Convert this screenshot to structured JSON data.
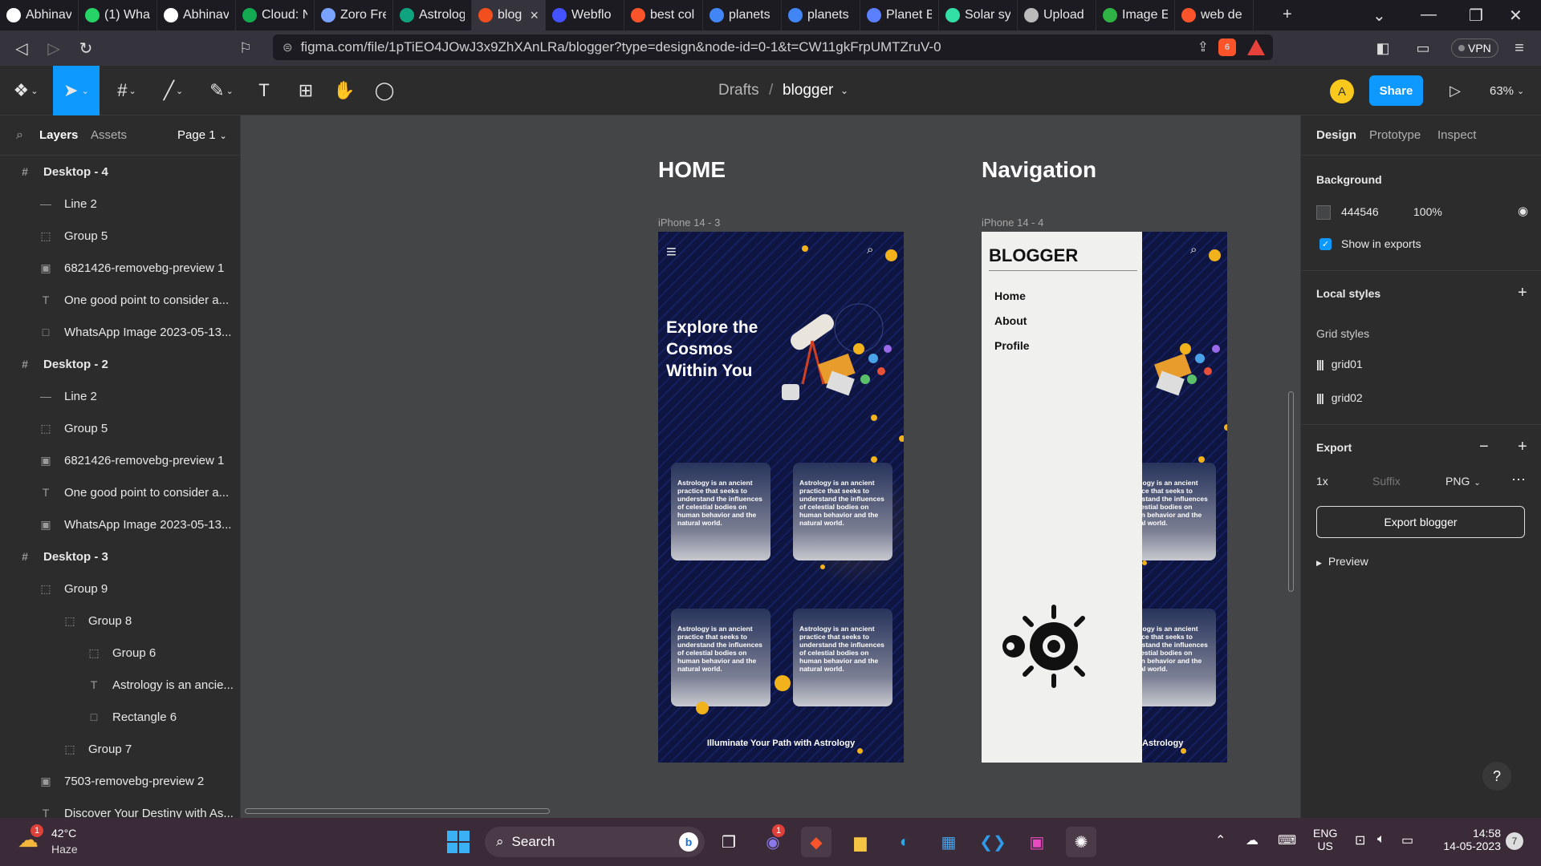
{
  "browser": {
    "tabs": [
      {
        "label": "Abhinav",
        "icon": "github-icon",
        "color": "#ffffff"
      },
      {
        "label": "(1) Wha",
        "icon": "whatsapp-icon",
        "color": "#25d366"
      },
      {
        "label": "Abhinav",
        "icon": "webflow-w-icon",
        "color": "#ffffff"
      },
      {
        "label": "Cloud: N",
        "icon": "mongodb-leaf-icon",
        "color": "#13aa52"
      },
      {
        "label": "Zoro Fre",
        "icon": "zoro-icon",
        "color": "#7aa3ff"
      },
      {
        "label": "Astrolog",
        "icon": "chatgpt-icon",
        "color": "#10a37f"
      },
      {
        "label": "blog",
        "icon": "figma-icon",
        "color": "#f24e1e"
      },
      {
        "label": "Webflo",
        "icon": "webflow-icon",
        "color": "#4353ff"
      },
      {
        "label": "best col",
        "icon": "brave-search-icon",
        "color": "#fb542b"
      },
      {
        "label": "planets",
        "icon": "google-icon",
        "color": "#4285f4"
      },
      {
        "label": "planets",
        "icon": "google-icon",
        "color": "#4285f4"
      },
      {
        "label": "Planet B",
        "icon": "planet-icon",
        "color": "#5b7fff"
      },
      {
        "label": "Solar sy",
        "icon": "vuetify-icon",
        "color": "#32e0a6"
      },
      {
        "label": "Upload",
        "icon": "stack-icon",
        "color": "#bbbbbb"
      },
      {
        "label": "Image E",
        "icon": "image-editor-icon",
        "color": "#2fb344"
      },
      {
        "label": "web de",
        "icon": "brave-search-icon",
        "color": "#fb542b"
      }
    ],
    "url": "figma.com/file/1pTiEO4JOwJ3x9ZhXAnLRa/blogger?type=design&node-id=0-1&t=CW11gkFrpUMTZruV-0",
    "vpn_label": "VPN",
    "brave_badge": "6",
    "alert_badge": "1"
  },
  "figma": {
    "breadcrumb_parent": "Drafts",
    "breadcrumb_sep": "/",
    "file_name": "blogger",
    "avatar_initial": "A",
    "share_label": "Share",
    "zoom": "63%",
    "left_tabs": {
      "layers": "Layers",
      "assets": "Assets",
      "page": "Page 1"
    },
    "layers": [
      {
        "label": "Desktop - 4",
        "icon": "#",
        "indent": 0,
        "bold": true
      },
      {
        "label": "Line 2",
        "icon": "—",
        "indent": 1,
        "bold": false
      },
      {
        "label": "Group 5",
        "icon": "⬚",
        "indent": 1,
        "bold": false
      },
      {
        "label": "6821426-removebg-preview 1",
        "icon": "▣",
        "indent": 1,
        "bold": false
      },
      {
        "label": "One good point to consider a...",
        "icon": "T",
        "indent": 1,
        "bold": false
      },
      {
        "label": "WhatsApp Image 2023-05-13...",
        "icon": "□",
        "indent": 1,
        "bold": false
      },
      {
        "label": "Desktop - 2",
        "icon": "#",
        "indent": 0,
        "bold": true
      },
      {
        "label": "Line 2",
        "icon": "—",
        "indent": 1,
        "bold": false
      },
      {
        "label": "Group 5",
        "icon": "⬚",
        "indent": 1,
        "bold": false
      },
      {
        "label": "6821426-removebg-preview 1",
        "icon": "▣",
        "indent": 1,
        "bold": false
      },
      {
        "label": "One good point to consider a...",
        "icon": "T",
        "indent": 1,
        "bold": false
      },
      {
        "label": "WhatsApp Image 2023-05-13...",
        "icon": "▣",
        "indent": 1,
        "bold": false
      },
      {
        "label": "Desktop - 3",
        "icon": "#",
        "indent": 0,
        "bold": true
      },
      {
        "label": "Group 9",
        "icon": "⬚",
        "indent": 1,
        "bold": false
      },
      {
        "label": "Group 8",
        "icon": "⬚",
        "indent": 2,
        "bold": false
      },
      {
        "label": "Group 6",
        "icon": "⬚",
        "indent": 3,
        "bold": false
      },
      {
        "label": "Astrology is an ancie...",
        "icon": "T",
        "indent": 3,
        "bold": false
      },
      {
        "label": "Rectangle 6",
        "icon": "□",
        "indent": 3,
        "bold": false
      },
      {
        "label": "Group 7",
        "icon": "⬚",
        "indent": 2,
        "bold": false
      },
      {
        "label": "7503-removebg-preview 2",
        "icon": "▣",
        "indent": 1,
        "bold": false
      },
      {
        "label": "Discover Your Destiny with As...",
        "icon": "T",
        "indent": 1,
        "bold": false
      }
    ],
    "right_tabs": {
      "design": "Design",
      "prototype": "Prototype",
      "inspect": "Inspect"
    },
    "background": {
      "title": "Background",
      "hex": "444546",
      "opacity": "100%",
      "show_exports": "Show in exports"
    },
    "local_styles": {
      "title": "Local styles",
      "grid_title": "Grid styles",
      "grids": [
        "grid01",
        "grid02"
      ]
    },
    "export": {
      "title": "Export",
      "scale": "1x",
      "suffix_placeholder": "Suffix",
      "format": "PNG",
      "button": "Export blogger",
      "preview": "Preview"
    }
  },
  "canvas": {
    "home_heading": "HOME",
    "nav_heading": "Navigation",
    "frame1_label": "iPhone 14 - 3",
    "frame2_label": "iPhone 14 - 4",
    "hero_line1": "Explore the",
    "hero_line2": "Cosmos",
    "hero_line3": "Within You",
    "card_text": "Astrology is an ancient practice that seeks to understand the influences of celestial bodies on human behavior and the natural world.",
    "footer_text": "Illuminate Your Path with Astrology",
    "footer_partial": "Astrology",
    "nav_brand": "BLOGGER",
    "nav_items": [
      "Home",
      "About",
      "Profile"
    ]
  },
  "taskbar": {
    "weather_temp": "42°C",
    "weather_desc": "Haze",
    "weather_badge": "1",
    "search_label": "Search",
    "teams_badge": "1",
    "lang_line1": "ENG",
    "lang_line2": "US",
    "time": "14:58",
    "date": "14-05-2023",
    "notif_badge": "7"
  },
  "colors": {
    "canvas_bg": "#444546",
    "panel_bg": "#2c2c2c",
    "accent": "#0d99ff",
    "gold": "#f1b21c",
    "phone_bg": "#0d1540"
  }
}
